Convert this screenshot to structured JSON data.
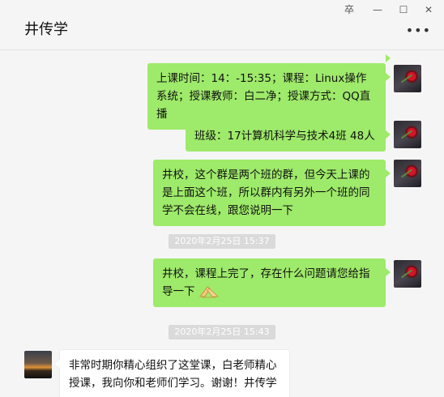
{
  "window": {
    "title": "井传学",
    "pin_label": "卒",
    "minimize_label": "—",
    "maximize_label": "☐",
    "close_label": "✕",
    "more_label": "•••"
  },
  "messages": [
    {
      "text": "上课时间：14：-15:35；课程：Linux操作系统；授课教师：白二净；授课方式：QQ直播"
    },
    {
      "text": "班级：17计算机科学与技术4班 48人"
    },
    {
      "text": "井校，这个群是两个班的群，但今天上课的是上面这个班，所以群内有另外一个班的同学不会在线，跟您说明一下"
    },
    {
      "text": "井校，课程上完了，存在什么问题请您给指导一下",
      "emoji": "praying-hands"
    },
    {
      "text": "非常时期你精心组织了这堂课，白老师精心授课，我向你和老师们学习。谢谢！井传学"
    }
  ],
  "timestamps": [
    "2020年2月25日 15:37",
    "2020年2月25日 15:43"
  ],
  "colors": {
    "outgoing_bubble": "#9eea6a",
    "incoming_bubble": "#ffffff",
    "background": "#f5f5f5",
    "timestamp_bg": "#dadada"
  }
}
